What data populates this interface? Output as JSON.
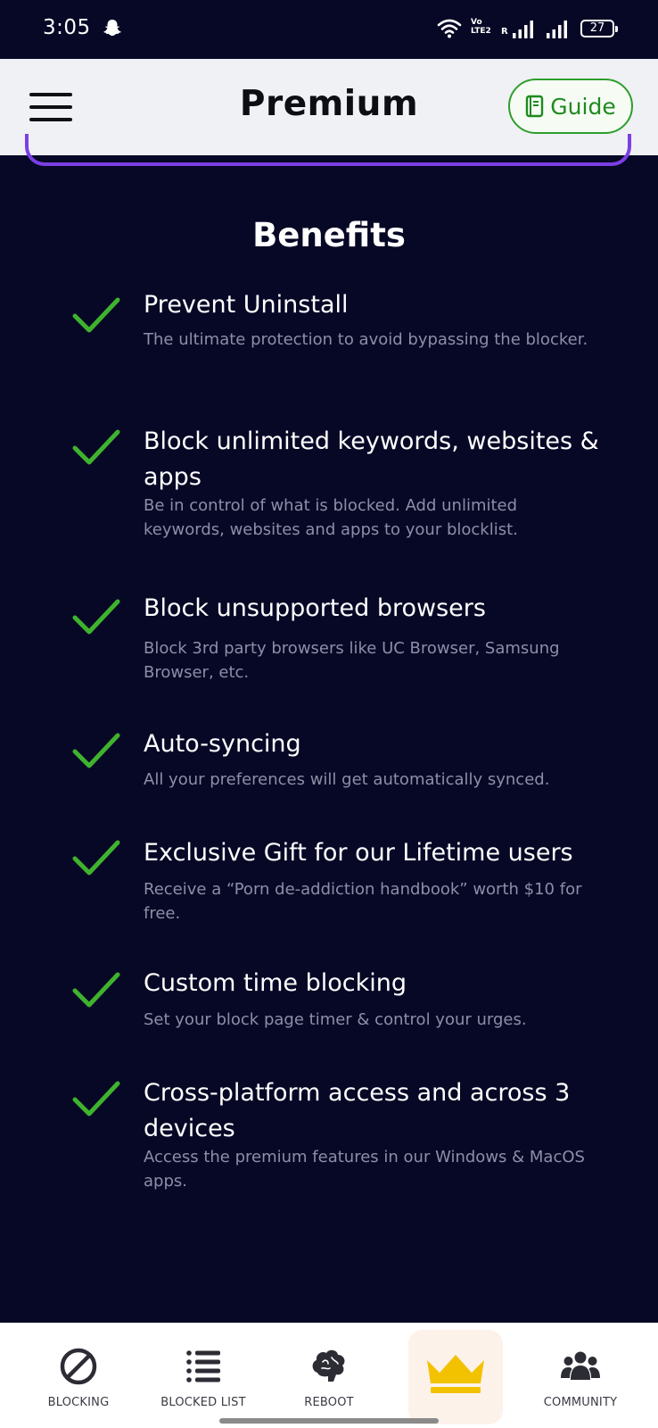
{
  "status_bar": {
    "time": "3:05",
    "volte_line1": "Vo",
    "volte_line2": "LTE2",
    "roaming": "R",
    "battery": "27"
  },
  "app_bar": {
    "title": "Premium",
    "guide_label": "Guide"
  },
  "benefits": {
    "heading": "Benefits",
    "items": [
      {
        "title": "Prevent Uninstall",
        "description": "The ultimate protection to avoid bypassing the blocker."
      },
      {
        "title": "Block unlimited keywords, websites & apps",
        "description": "Be in control of what is blocked. Add unlimited keywords, websites and apps to your blocklist."
      },
      {
        "title": "Block unsupported browsers",
        "description": "Block 3rd party browsers like UC Browser, Samsung Browser, etc."
      },
      {
        "title": "Auto-syncing",
        "description": "All your preferences will get automatically synced."
      },
      {
        "title": "Exclusive Gift for our Lifetime users",
        "description": "Receive a “Porn de-addiction handbook” worth $10 for free."
      },
      {
        "title": "Custom time blocking",
        "description": "Set your block page timer & control your urges."
      },
      {
        "title": "Cross-platform access and across 3 devices",
        "description": "Access the premium features in our Windows & MacOS apps."
      }
    ]
  },
  "bottom_nav": {
    "items": [
      {
        "label": "BLOCKING",
        "icon": "block-icon"
      },
      {
        "label": "BLOCKED LIST",
        "icon": "list-icon"
      },
      {
        "label": "REBOOT",
        "icon": "brain-icon"
      },
      {
        "label": "",
        "icon": "crown-icon",
        "active": true
      },
      {
        "label": "COMMUNITY",
        "icon": "community-icon"
      }
    ]
  },
  "colors": {
    "background": "#070826",
    "check": "#3fb22e",
    "guide_green": "#2e9e2e",
    "accent_purple": "#7b3fe4",
    "crown": "#f2c200"
  }
}
